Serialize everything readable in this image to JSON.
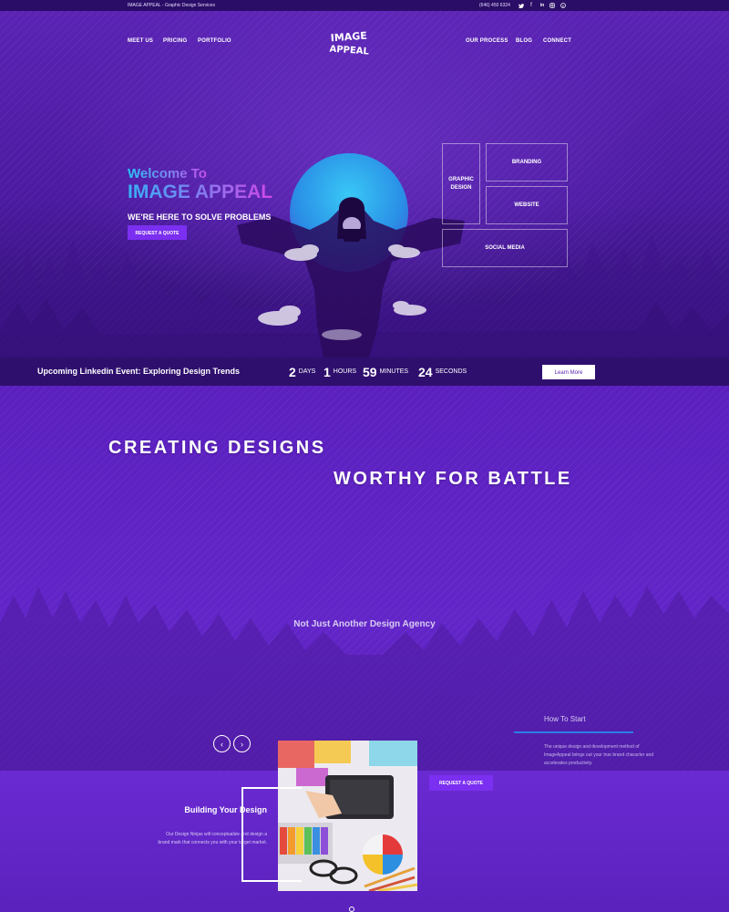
{
  "topbar": {
    "tagline": "IMAGE APPEAL - Graphic Design Services",
    "phone": "(646) 450 6324",
    "social_icons": [
      "twitter-icon",
      "facebook-icon",
      "linkedin-icon",
      "instagram-icon",
      "pinterest-icon"
    ]
  },
  "nav": {
    "left": [
      "MEET US",
      "PRICING",
      "PORTFOLIO"
    ],
    "right": [
      "OUR PROCESS",
      "BLOG",
      "CONNECT"
    ]
  },
  "logo": {
    "line1": "IMAGE",
    "line2": "APPEAL"
  },
  "hero": {
    "welcome": "Welcome To",
    "brand": "IMAGE APPEAL",
    "tagline": "WE'RE HERE TO SOLVE PROBLEMS",
    "cta": "REQUEST A QUOTE"
  },
  "services": {
    "graphic_design": "GRAPHIC DESIGN",
    "branding": "BRANDING",
    "website": "WEBSITE",
    "social_media": "SOCIAL MEDIA"
  },
  "event": {
    "title": "Upcoming Linkedin Event: Exploring Design Trends",
    "countdown": [
      {
        "value": "2",
        "unit": "DAYS"
      },
      {
        "value": "1",
        "unit": "HOURS"
      },
      {
        "value": "59",
        "unit": "MINUTES"
      },
      {
        "value": "24",
        "unit": "SECONDS"
      }
    ],
    "button": "Learn More"
  },
  "section2": {
    "headline1": "CREATING DESIGNS",
    "headline2": "WORTHY FOR BATTLE",
    "subhead": "Not Just Another Design Agency",
    "how_title": "How To Start",
    "how_text": "The unique design and development method of ImageAppeal brings out your true brand character and accelerates productivity.",
    "cta": "REQUEST A QUOTE",
    "card_title": "Building Your Design",
    "card_text": "Our Design Ninjas will conceptualize and design a brand mark that connects you with your target market.",
    "prev_arrow": "‹",
    "next_arrow": "›"
  },
  "colors": {
    "accent": "#7b2ff0",
    "background": "#5b20bf",
    "dark_bar": "#2e0f6d",
    "line": "#2b7fe6"
  }
}
